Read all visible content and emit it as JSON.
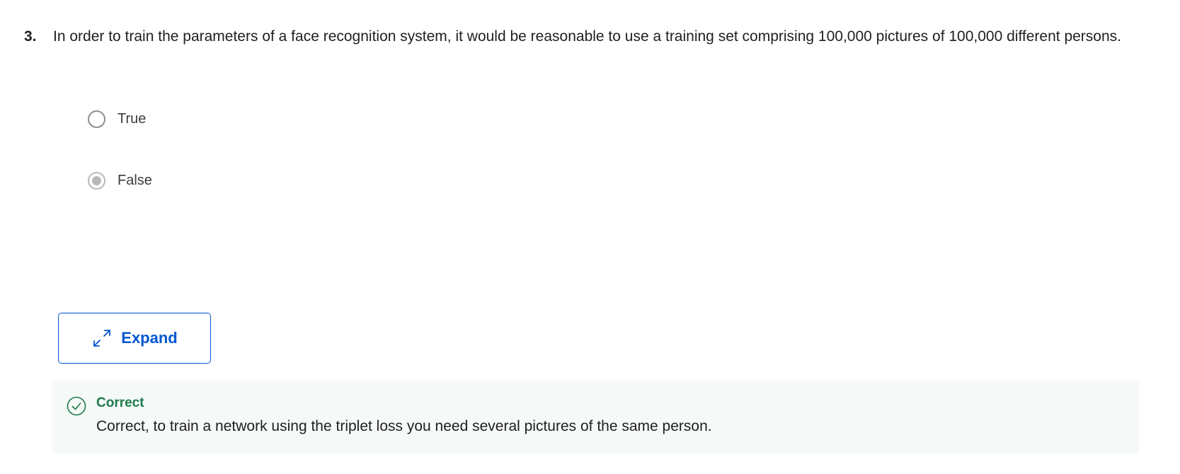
{
  "question": {
    "number": "3.",
    "text": "In order to train the parameters of a face recognition system, it would be reasonable to use a training set comprising 100,000 pictures of 100,000 different persons."
  },
  "options": [
    {
      "label": "True",
      "selected": false
    },
    {
      "label": "False",
      "selected": true
    }
  ],
  "expand_button": {
    "label": "Expand",
    "icon": "expand-arrows-icon"
  },
  "feedback": {
    "status": "Correct",
    "icon": "check-circle-icon",
    "message": "Correct, to train a network using the triplet loss you need several pictures of the same person.",
    "accent_color": "#1d7a4c"
  },
  "colors": {
    "link": "#0056d2",
    "feedback_bg": "#f5f9f7"
  }
}
